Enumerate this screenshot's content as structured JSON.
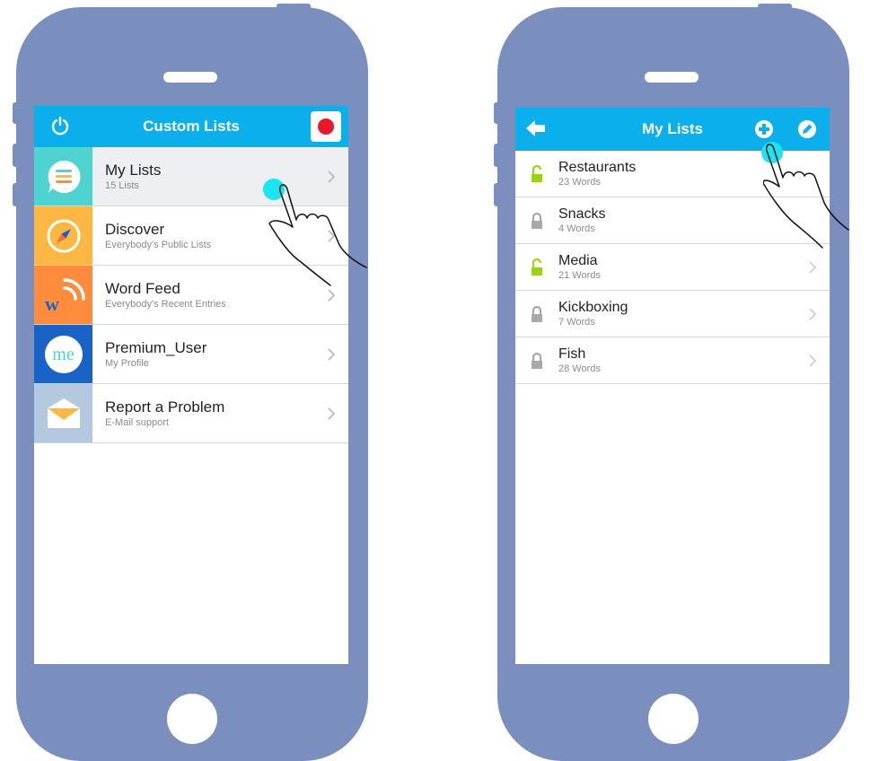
{
  "colors": {
    "phone": "#7a8fbd",
    "accent": "#0aafec",
    "record": "#e8192c",
    "touch": "#19e6f0",
    "lock_unlocked": "#9bd318",
    "lock_locked": "#a9a9a9"
  },
  "left_screen": {
    "header": {
      "title": "Custom Lists",
      "left_icon": "power-icon",
      "right_icon": "record-icon"
    },
    "menu": [
      {
        "label": "My Lists",
        "subtitle": "15 Lists",
        "icon": "speech-bubble-icon",
        "tile_color": "#4ed3d1",
        "selected": true
      },
      {
        "label": "Discover",
        "subtitle": "Everybody's Public Lists",
        "icon": "compass-icon",
        "tile_color": "#fcb843"
      },
      {
        "label": "Word Feed",
        "subtitle": "Everybody's Recent Entries",
        "icon": "word-feed-icon",
        "tile_color": "#ff8b3d"
      },
      {
        "label": "Premium_User",
        "subtitle": "My Profile",
        "icon": "me-avatar-icon",
        "tile_color": "#1a63c6",
        "avatar_text": "me"
      },
      {
        "label": "Report a Problem",
        "subtitle": "E-Mail support",
        "icon": "envelope-icon",
        "tile_color": "#b4c8e0"
      }
    ]
  },
  "right_screen": {
    "header": {
      "title": "My Lists",
      "left_icon": "back-arrow-icon",
      "icons": [
        "add-icon",
        "edit-icon"
      ]
    },
    "lists": [
      {
        "label": "Restaurants",
        "subtitle": "23 Words",
        "locked": false
      },
      {
        "label": "Snacks",
        "subtitle": "4 Words",
        "locked": true
      },
      {
        "label": "Media",
        "subtitle": "21 Words",
        "locked": false
      },
      {
        "label": "Kickboxing",
        "subtitle": "7 Words",
        "locked": true
      },
      {
        "label": "Fish",
        "subtitle": "28 Words",
        "locked": true
      }
    ]
  }
}
